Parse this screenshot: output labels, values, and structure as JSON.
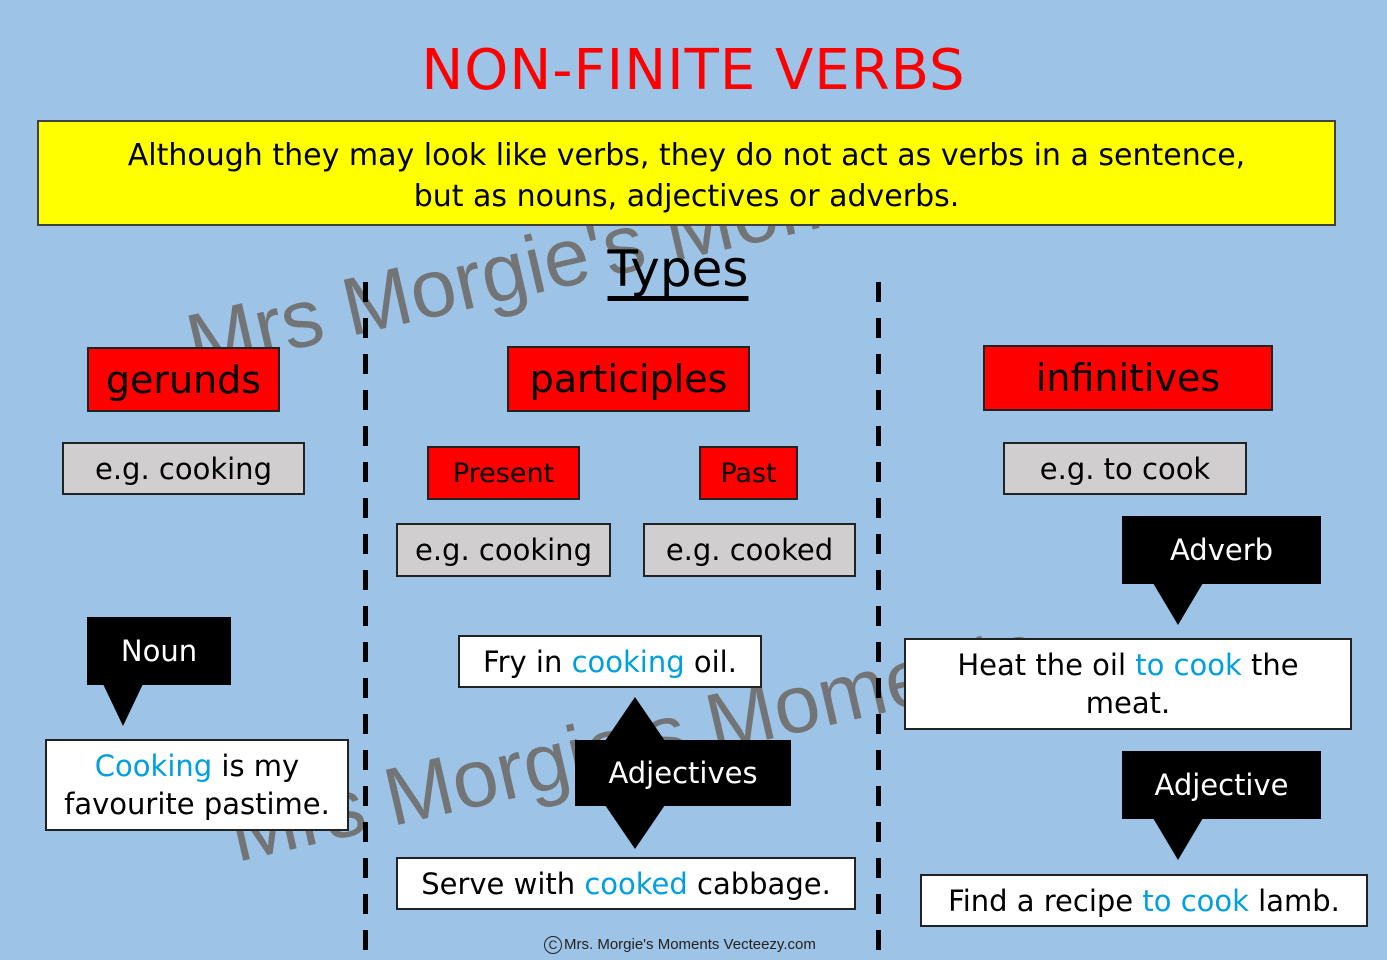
{
  "title": "NON-FINITE VERBS",
  "definition": {
    "line1": "Although they may look like verbs, they do not act as verbs in a sentence,",
    "line2": "but as nouns, adjectives or adverbs."
  },
  "watermark": {
    "line1": "Mrs Morgie's Moments",
    "line2": "Mrs Morgie's Moments"
  },
  "types_heading": "Types",
  "colors": {
    "background": "#9dc3e6",
    "title": "#ff0000",
    "definition_bg": "#ffff00",
    "category_bg": "#ff0000",
    "example_bg": "#d0cece",
    "label_bg": "#000000",
    "highlight": "#00a0e0"
  },
  "columns": {
    "gerunds": {
      "label": "gerunds",
      "example": "e.g. cooking",
      "function_label": "Noun",
      "sentence": {
        "highlight": "Cooking",
        "after": " is my favourite pastime."
      }
    },
    "participles": {
      "label": "participles",
      "present": {
        "label": "Present",
        "example": "e.g. cooking"
      },
      "past": {
        "label": "Past",
        "example": "e.g. cooked"
      },
      "function_label": "Adjectives",
      "sentence1": {
        "before": "Fry in ",
        "highlight": "cooking",
        "after": " oil."
      },
      "sentence2": {
        "before": "Serve with ",
        "highlight": "cooked",
        "after": " cabbage."
      }
    },
    "infinitives": {
      "label": "infinitives",
      "example": "e.g. to cook",
      "function_label_1": "Adverb",
      "sentence1": {
        "before": "Heat the oil ",
        "highlight": "to cook",
        "after": " the meat."
      },
      "function_label_2": "Adjective",
      "sentence2": {
        "before": "Find a recipe ",
        "highlight": "to cook",
        "after": " lamb."
      }
    }
  },
  "copyright": {
    "symbol": "C",
    "text": "Mrs. Morgie's Moments   Vecteezy.com"
  }
}
